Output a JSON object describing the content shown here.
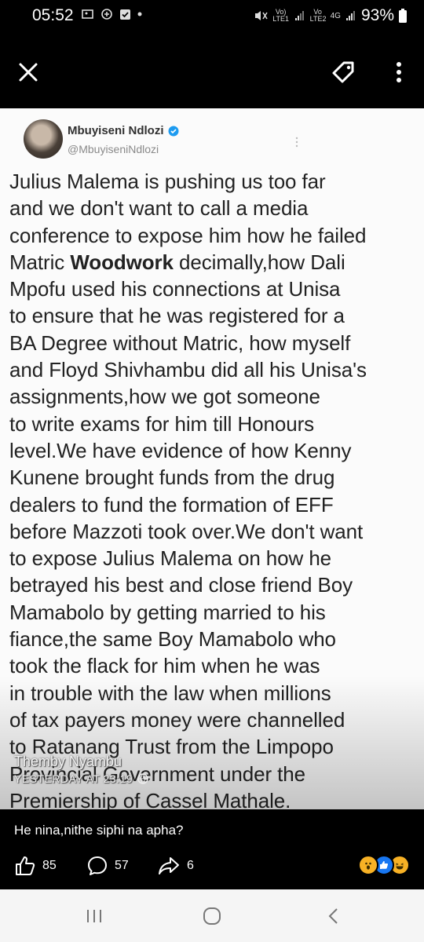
{
  "status_bar": {
    "time": "05:52",
    "network_left": "Vo) LTE1",
    "network_right": "Vo LTE2",
    "network_type": "4G",
    "battery": "93%"
  },
  "toolbar": {
    "close_icon": "close-icon",
    "tag_icon": "tag-icon",
    "more_icon": "more-vert-icon"
  },
  "tweet": {
    "author_name": "Mbuyiseni Ndlozi",
    "author_handle": "@MbuyiseniNdlozi",
    "lines": [
      "Julius Malema is pushing us too far",
      "and we don't want to call a media",
      "conference to expose him how he failed",
      "Matric ",
      "Woodwork",
      " decimally,how Dali",
      "Mpofu used his connections at Unisa",
      "to ensure that he was registered for a",
      "BA Degree without Matric, how myself",
      "and Floyd Shivhambu did all his Unisa's",
      "assignments,how we got someone",
      "to write exams for him till Honours",
      "level.We have evidence of how Kenny",
      "Kunene brought funds from the drug",
      "dealers to fund the formation of EFF",
      "before Mazzoti took over.We don't want",
      "to expose Julius Malema on how he",
      "betrayed his best and close friend Boy",
      "Mamabolo by getting married to his",
      "fiance,the same Boy Mamabolo who",
      "took the flack for him when he was",
      "in trouble with the law when millions",
      "of tax payers money were channelled",
      "to Ratanang Trust from the Limpopo",
      "Provincial Government under the",
      "Premiership of Cassel Mathale."
    ]
  },
  "watermark": {
    "name": "Themby Nyambu",
    "time": "YESTERDAY AT 23:19"
  },
  "post": {
    "caption": "He nina,nithe siphi na apha?",
    "likes": "85",
    "comments": "57",
    "shares": "6"
  },
  "colors": {
    "background": "#000000",
    "verified": "#1d9bf0",
    "like_reaction": "#1877f2",
    "wow_reaction": "#f7b125"
  }
}
